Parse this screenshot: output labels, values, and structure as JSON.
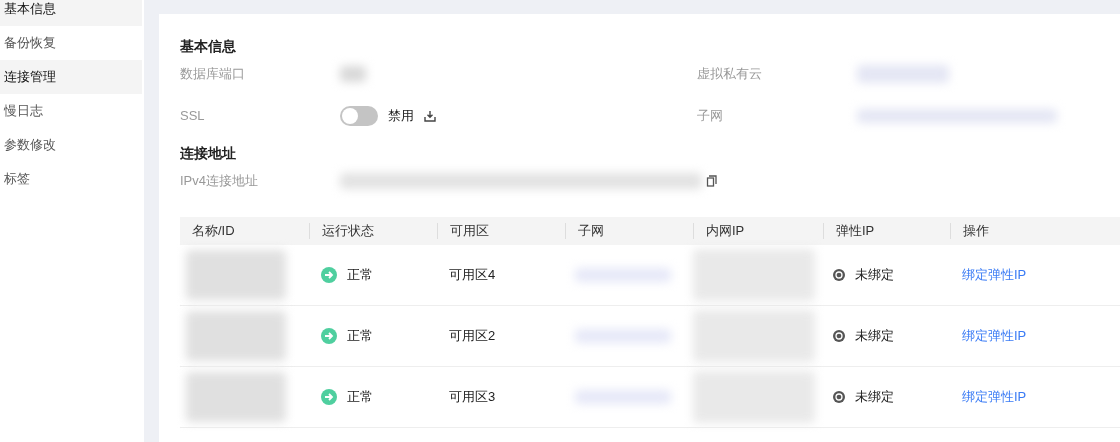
{
  "sidebar": {
    "items": [
      {
        "label": "基本信息",
        "highlighted": true
      },
      {
        "label": "备份恢复",
        "highlighted": false
      },
      {
        "label": "连接管理",
        "highlighted": true
      },
      {
        "label": "慢日志",
        "highlighted": false
      },
      {
        "label": "参数修改",
        "highlighted": false
      },
      {
        "label": "标签",
        "highlighted": false
      }
    ]
  },
  "basic_info": {
    "title": "基本信息",
    "fields": [
      {
        "label": "数据库端口",
        "kind": "redacted"
      },
      {
        "label": "虚拟私有云",
        "kind": "redacted-link"
      },
      {
        "label": "SSL",
        "kind": "switch",
        "on": false,
        "value": "禁用"
      },
      {
        "label": "子网",
        "kind": "redacted-link"
      }
    ]
  },
  "connection": {
    "title": "连接地址",
    "fields": [
      {
        "label": "IPv4连接地址",
        "kind": "redacted-copy"
      }
    ]
  },
  "table": {
    "columns": [
      "名称/ID",
      "运行状态",
      "可用区",
      "子网",
      "内网IP",
      "弹性IP",
      "操作"
    ],
    "rows": [
      {
        "status": "正常",
        "zone": "可用区4",
        "eip": "未绑定",
        "action": "绑定弹性IP"
      },
      {
        "status": "正常",
        "zone": "可用区2",
        "eip": "未绑定",
        "action": "绑定弹性IP"
      },
      {
        "status": "正常",
        "zone": "可用区3",
        "eip": "未绑定",
        "action": "绑定弹性IP"
      }
    ]
  }
}
